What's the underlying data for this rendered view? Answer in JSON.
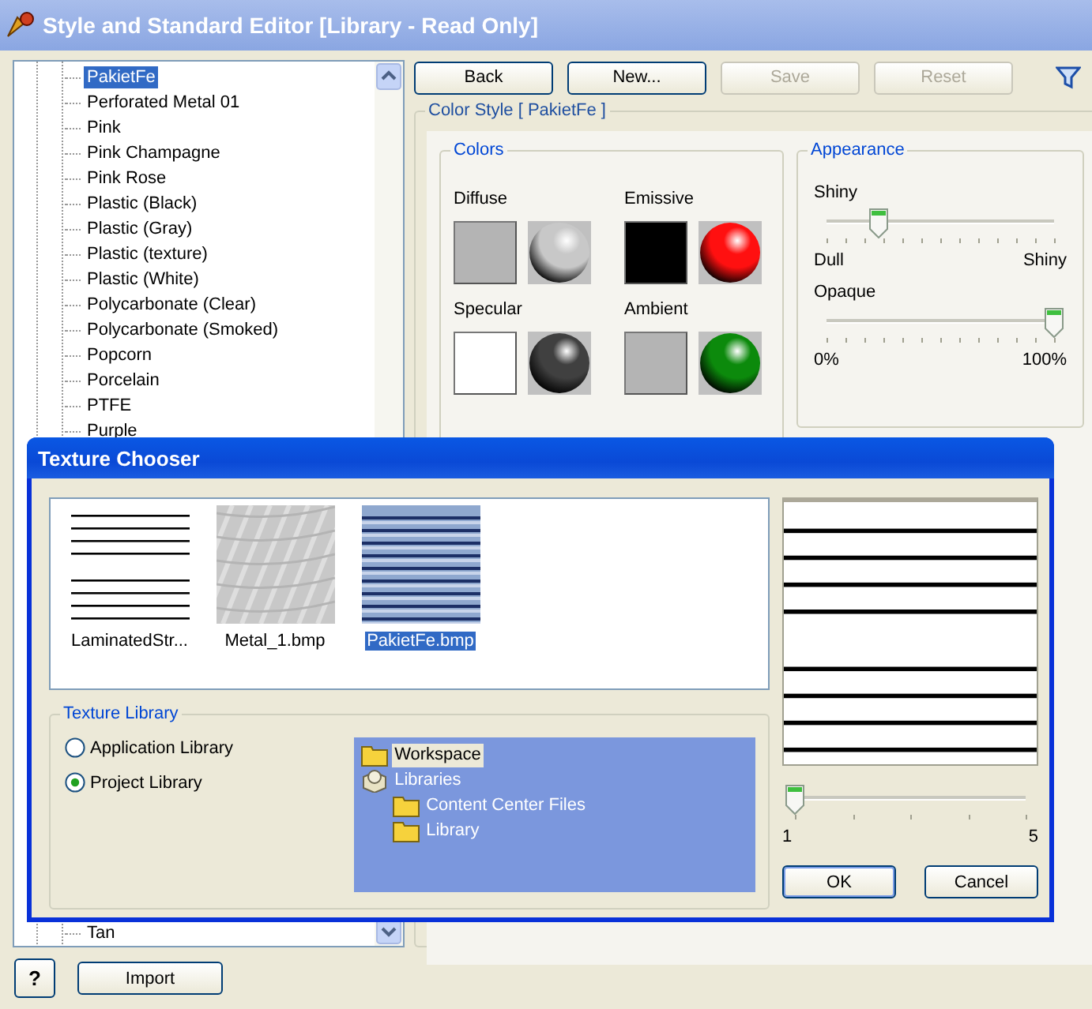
{
  "window": {
    "title": "Style and Standard Editor [Library - Read Only]"
  },
  "style_tree": {
    "items": [
      {
        "label": "PakietFe",
        "selected": true
      },
      {
        "label": "Perforated Metal 01",
        "selected": false
      },
      {
        "label": "Pink",
        "selected": false
      },
      {
        "label": "Pink Champagne",
        "selected": false
      },
      {
        "label": "Pink Rose",
        "selected": false
      },
      {
        "label": "Plastic (Black)",
        "selected": false
      },
      {
        "label": "Plastic (Gray)",
        "selected": false
      },
      {
        "label": "Plastic (texture)",
        "selected": false
      },
      {
        "label": "Plastic (White)",
        "selected": false
      },
      {
        "label": "Polycarbonate (Clear)",
        "selected": false
      },
      {
        "label": "Polycarbonate (Smoked)",
        "selected": false
      },
      {
        "label": "Popcorn",
        "selected": false
      },
      {
        "label": "Porcelain",
        "selected": false
      },
      {
        "label": "PTFE",
        "selected": false
      },
      {
        "label": "Purple",
        "selected": false
      }
    ],
    "last_item": {
      "label": "Tan",
      "selected": false
    }
  },
  "toolbar": {
    "buttons": [
      {
        "label": "Back",
        "disabled": false
      },
      {
        "label": "New...",
        "disabled": false
      },
      {
        "label": "Save",
        "disabled": true
      },
      {
        "label": "Reset",
        "disabled": true
      }
    ]
  },
  "color_style": {
    "title": "Color Style [ PakietFe ]",
    "colors": {
      "title": "Colors",
      "swatches": [
        {
          "label": "Diffuse",
          "color": "#b4b4b4",
          "sphere": {
            "color": "#c8c8c8"
          }
        },
        {
          "label": "Emissive",
          "color": "#000000",
          "sphere": {
            "color": "#ff1010"
          }
        },
        {
          "label": "Specular",
          "color": "#ffffff",
          "sphere": {
            "color": "#404040"
          }
        },
        {
          "label": "Ambient",
          "color": "#b4b4b4",
          "sphere": {
            "color": "#0c8a0c"
          }
        }
      ]
    },
    "appearance": {
      "title": "Appearance",
      "sliders": [
        {
          "label": "Shiny",
          "level": 0.23,
          "min_label": "Dull",
          "max_label": "Shiny"
        },
        {
          "label": "Opaque",
          "level": 1,
          "min_label": "0%",
          "max_label": "100%"
        }
      ]
    }
  },
  "texture_chooser": {
    "title": "Texture Chooser",
    "textures": [
      {
        "name": "LaminatedStr...",
        "kind": "lines",
        "selected": false
      },
      {
        "name": "Metal_1.bmp",
        "kind": "metal",
        "selected": false
      },
      {
        "name": "PakietFe.bmp",
        "kind": "hatched",
        "selected": true
      }
    ],
    "preview": {
      "kind": "lines"
    },
    "library": {
      "title": "Texture Library",
      "options": [
        {
          "label": "Application Library",
          "selected": false
        },
        {
          "label": "Project Library",
          "selected": true
        }
      ],
      "tree": [
        {
          "label": "Workspace",
          "kind": "folder",
          "selected": true
        },
        {
          "label": "Libraries",
          "kind": "library",
          "selected": false,
          "children": [
            {
              "label": "Content Center Files",
              "kind": "folder",
              "selected": false
            },
            {
              "label": "Library",
              "kind": "folder",
              "selected": false
            }
          ]
        }
      ]
    },
    "scale": {
      "level": 0,
      "min_label": "1",
      "max_label": "5"
    },
    "buttons": [
      "OK",
      "Cancel"
    ]
  },
  "footer": {
    "help_button": "?",
    "import_button": "Import"
  }
}
